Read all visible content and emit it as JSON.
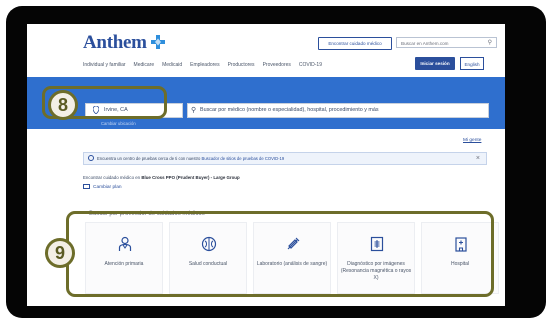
{
  "header": {
    "logo_text": "Anthem",
    "find_care_button": "Encontrar cuidado médico",
    "search_placeholder": "Buscar en Anthem.com",
    "login_button": "Iniciar sesión",
    "language_button": "English",
    "nav": [
      "Individual y familiar",
      "Medicare",
      "Medicaid",
      "Empleadores",
      "Productores",
      "Proveedores",
      "COVID-19"
    ]
  },
  "search": {
    "location_value": "Irvine, CA",
    "change_location": "Cambiar ubicación",
    "query_placeholder": "Buscar por médico (nombre o especialidad), hospital, procedimiento y más"
  },
  "help_link": "Mi gente",
  "alert": {
    "text": "Encuentra un centro de pruebas cerca de ti con nuestro",
    "link": "Buscador de sitios de pruebas de COVID-19"
  },
  "plan": {
    "prefix": "Encontrar cuidado médico en",
    "plan_name": "Blue Cross PPO (Prudent Buyer) - Large Group",
    "change_plan": "Cambiar plan"
  },
  "section_label": "Buscar por proveedor de cuidados médicos",
  "categories": [
    {
      "label": "Atención primaria",
      "icon": "doctor-icon"
    },
    {
      "label": "Salud conductual",
      "icon": "brain-icon"
    },
    {
      "label": "Laboratorio (análisis de sangre)",
      "icon": "syringe-icon"
    },
    {
      "label": "Diagnóstico por imágenes (Resonancia magnética o rayos X)",
      "icon": "xray-icon"
    },
    {
      "label": "Hospital",
      "icon": "hospital-icon"
    }
  ],
  "callouts": {
    "search_badge": "8",
    "categories_badge": "9"
  },
  "colors": {
    "brand": "#2b4f9c",
    "banner": "#2f6fce",
    "callout": "#6d6d2a",
    "frame": "#050505"
  }
}
